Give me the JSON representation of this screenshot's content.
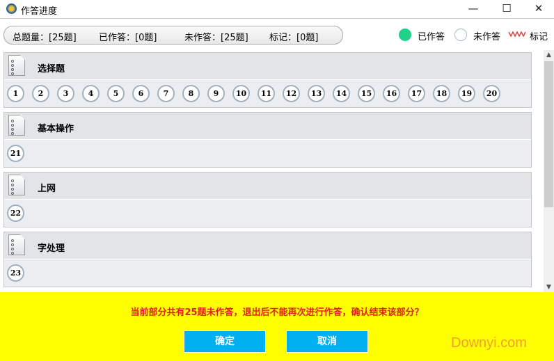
{
  "window": {
    "title": "作答进度",
    "minimize": "—",
    "maximize": "☐",
    "close": "✕"
  },
  "summary": {
    "total": "总题量：[25题]",
    "answered": "已作答：[0题]",
    "unanswered": "未作答：[25题]",
    "marked": "标记：[0题]"
  },
  "legend": {
    "answered": "已作答",
    "unanswered": "未作答",
    "marked": "标记"
  },
  "colors": {
    "answered": "#1fd28a",
    "footer": "#ffff00",
    "button": "#00b0f0",
    "message": "#e0201c"
  },
  "sections": [
    {
      "title": "选择题",
      "questions": [
        "1",
        "2",
        "3",
        "4",
        "5",
        "6",
        "7",
        "8",
        "9",
        "10",
        "11",
        "12",
        "13",
        "14",
        "15",
        "16",
        "17",
        "18",
        "19",
        "20"
      ]
    },
    {
      "title": "基本操作",
      "questions": [
        "21"
      ]
    },
    {
      "title": "上网",
      "questions": [
        "22"
      ]
    },
    {
      "title": "字处理",
      "questions": [
        "23"
      ]
    }
  ],
  "footer": {
    "message": "当前部分共有25题未作答，退出后不能再次进行作答，确认结束该部分？",
    "confirm": "确定",
    "cancel": "取消",
    "watermark": "Downyi.com"
  }
}
